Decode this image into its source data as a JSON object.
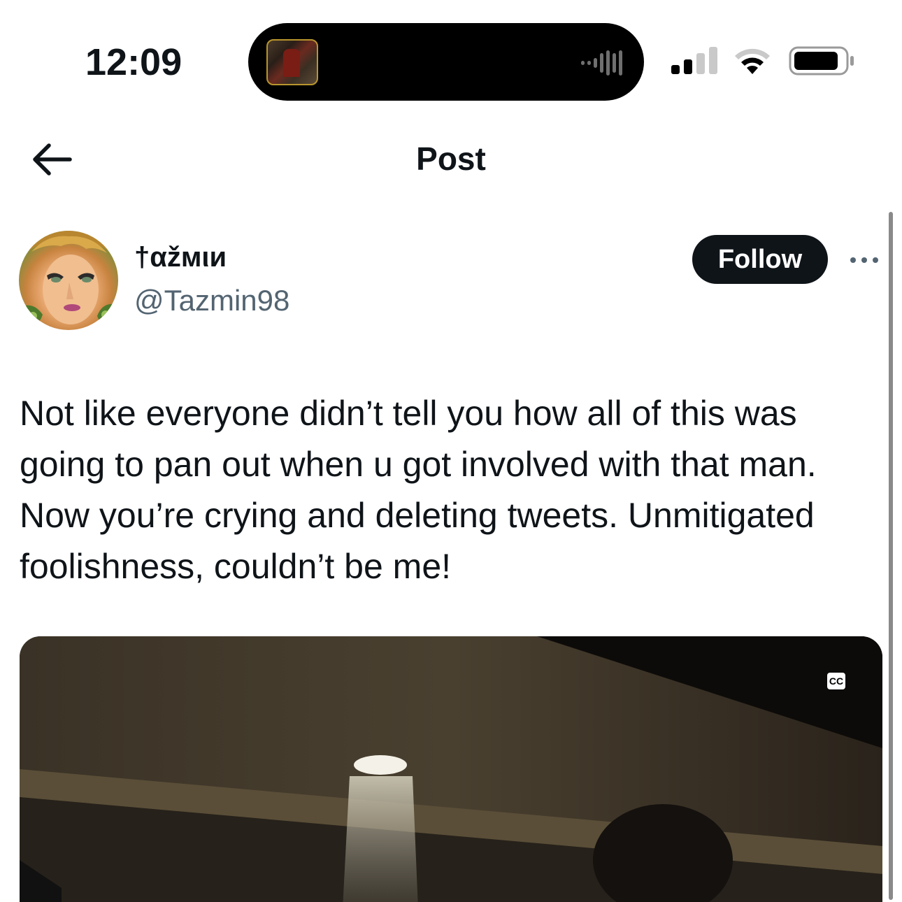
{
  "status_bar": {
    "time": "12:09",
    "icons": [
      "now-playing-artwork",
      "audio-waveform-icon",
      "cellular-signal-icon",
      "wifi-icon",
      "battery-icon"
    ]
  },
  "header": {
    "title": "Post",
    "back_icon": "arrow-left-icon"
  },
  "post": {
    "author": {
      "display_name": "†αžмιи",
      "handle": "@Tazmin98"
    },
    "follow_label": "Follow",
    "more_icon": "more-dots-icon",
    "text": "Not like everyone didn’t tell you how all of this was going to pan out when u got involved with that man. Now you’re crying and deleting tweets. Unmitigated foolishness, couldn’t be me!",
    "media": {
      "type": "video",
      "cc_label": "CC"
    }
  },
  "colors": {
    "text_primary": "#0f1419",
    "text_secondary": "#536471",
    "follow_button_bg": "#0f1419",
    "follow_button_text": "#ffffff"
  }
}
